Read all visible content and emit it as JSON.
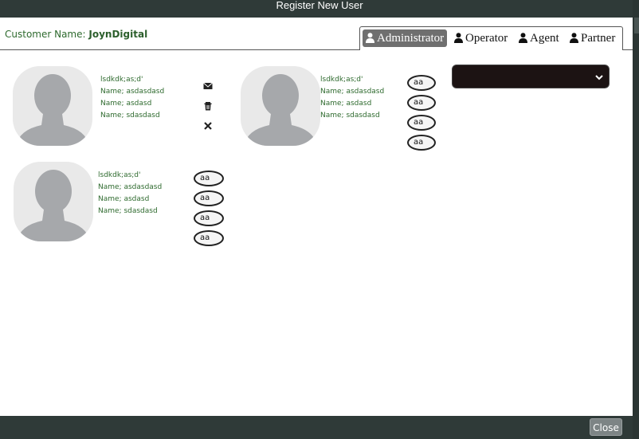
{
  "window": {
    "title": "Register New User"
  },
  "header": {
    "customer_label": "Customer Name:",
    "customer_value": "JoynDigital"
  },
  "tabs": [
    {
      "label": "Administrator",
      "active": true
    },
    {
      "label": "Operator",
      "active": false
    },
    {
      "label": "Agent",
      "active": false
    },
    {
      "label": "Partner",
      "active": false
    }
  ],
  "cards": [
    {
      "lines": [
        "lsdkdk;as;d'",
        "Name; asdasdasd",
        "Name; asdasd",
        "Name; sdasdasd"
      ],
      "actions": [
        "envelope-icon",
        "trash-icon",
        "close-icon"
      ]
    },
    {
      "lines": [
        "lsdkdk;as;d'",
        "Name; asdasdasd",
        "Name; asdasd",
        "Name; sdasdasd"
      ],
      "pills": [
        "aa",
        "aa",
        "aa",
        "aa"
      ]
    },
    {
      "lines": [
        "lsdkdk;as;d'",
        "Name; asdasdasd",
        "Name; asdasd",
        "Name; sdasdasd"
      ],
      "pills": [
        "aa",
        "aa",
        "aa",
        "aa"
      ]
    }
  ],
  "dropdown": {
    "value": "",
    "color": "#1c1313"
  },
  "footer": {
    "close_label": "Close"
  },
  "colors": {
    "accent_green": "#2e6a2e",
    "title_bar": "#2f3a38",
    "active_tab": "#6f6f6f"
  }
}
